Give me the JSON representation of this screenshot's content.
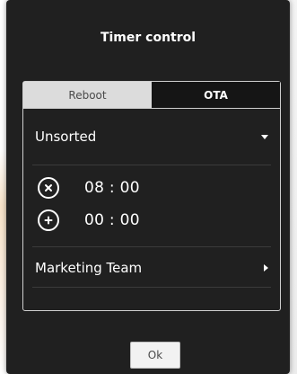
{
  "dialog": {
    "title": "Timer control",
    "tabs": [
      {
        "label": "Reboot",
        "active": false
      },
      {
        "label": "OTA",
        "active": true
      }
    ],
    "group_select": {
      "value": "Unsorted",
      "icon": "chevron-down-icon"
    },
    "timers": [
      {
        "time": "08 : 00",
        "action_icon": "remove-circle-icon"
      },
      {
        "time": "00 : 00",
        "action_icon": "add-circle-icon"
      }
    ],
    "group_nav": {
      "label": "Marketing Team",
      "icon": "chevron-right-icon"
    },
    "ok_label": "Ok"
  },
  "colors": {
    "dialog_bg": "#202020",
    "active_tab_bg": "#151515",
    "inactive_tab_bg": "#dcdcdc",
    "text": "#ffffff"
  }
}
